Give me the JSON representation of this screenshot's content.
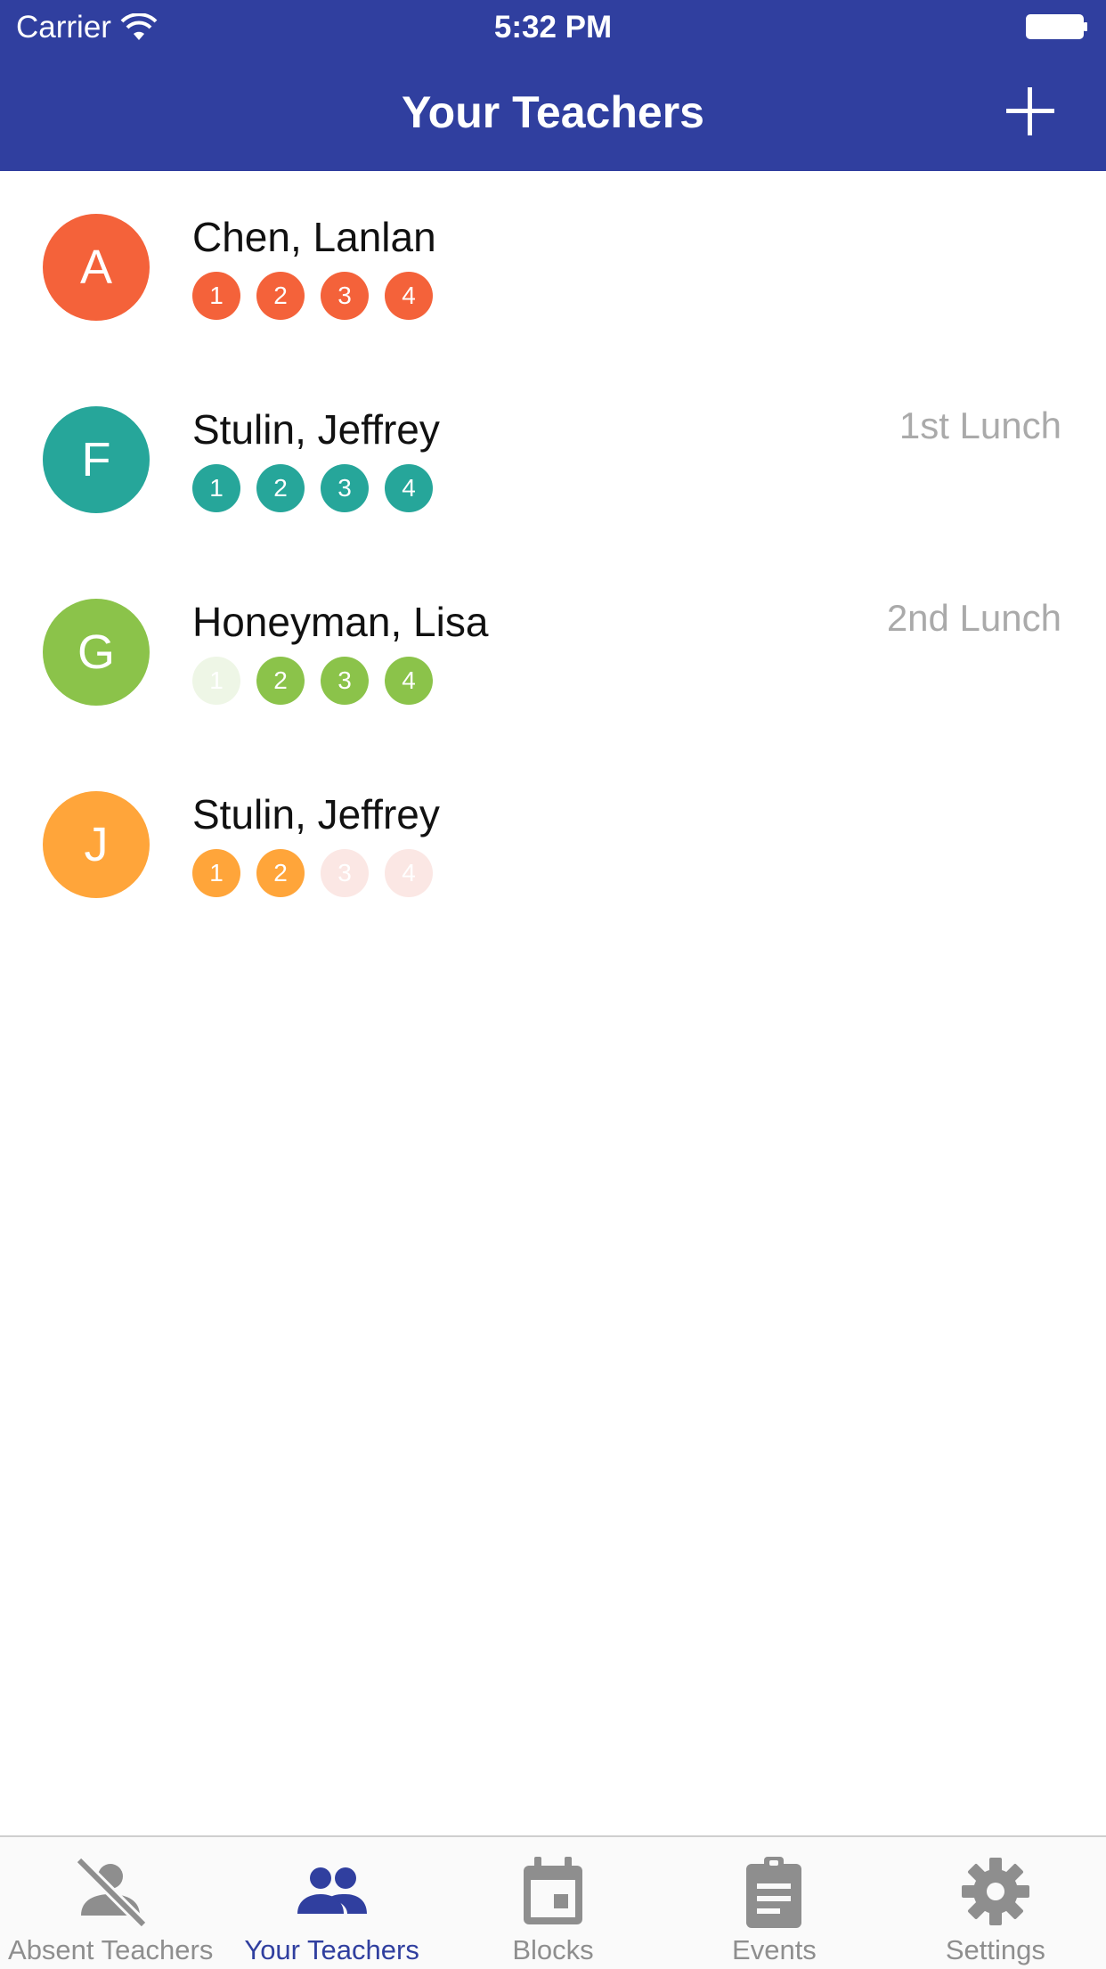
{
  "status_bar": {
    "carrier": "Carrier",
    "time": "5:32 PM"
  },
  "nav": {
    "title": "Your Teachers",
    "add_icon": "plus-icon"
  },
  "teachers": [
    {
      "initial": "A",
      "name": "Chen, Lanlan",
      "lunch": "",
      "color": "#F4623A",
      "blocks": [
        {
          "label": "1",
          "active": true
        },
        {
          "label": "2",
          "active": true
        },
        {
          "label": "3",
          "active": true
        },
        {
          "label": "4",
          "active": true
        }
      ]
    },
    {
      "initial": "F",
      "name": "Stulin, Jeffrey",
      "lunch": "1st Lunch",
      "color": "#26A69A",
      "blocks": [
        {
          "label": "1",
          "active": true
        },
        {
          "label": "2",
          "active": true
        },
        {
          "label": "3",
          "active": true
        },
        {
          "label": "4",
          "active": true
        }
      ]
    },
    {
      "initial": "G",
      "name": "Honeyman, Lisa",
      "lunch": "2nd Lunch",
      "color": "#8BC34A",
      "blocks": [
        {
          "label": "1",
          "active": false
        },
        {
          "label": "2",
          "active": true
        },
        {
          "label": "3",
          "active": true
        },
        {
          "label": "4",
          "active": true
        }
      ]
    },
    {
      "initial": "J",
      "name": "Stulin, Jeffrey",
      "lunch": "",
      "color": "#FFA53A",
      "blocks": [
        {
          "label": "1",
          "active": true
        },
        {
          "label": "2",
          "active": true
        },
        {
          "label": "3",
          "active": false
        },
        {
          "label": "4",
          "active": false
        }
      ]
    }
  ],
  "tabs": [
    {
      "label": "Absent Teachers",
      "icon": "person-off-icon",
      "active": false
    },
    {
      "label": "Your Teachers",
      "icon": "people-icon",
      "active": true
    },
    {
      "label": "Blocks",
      "icon": "calendar-icon",
      "active": false
    },
    {
      "label": "Events",
      "icon": "clipboard-icon",
      "active": false
    },
    {
      "label": "Settings",
      "icon": "gear-icon",
      "active": false
    }
  ],
  "colors": {
    "primary": "#303F9F",
    "inactive_tab": "#8e8e8e",
    "inactive_block_green": "#EEF6E6",
    "inactive_block_orange": "#FBE7E4"
  }
}
